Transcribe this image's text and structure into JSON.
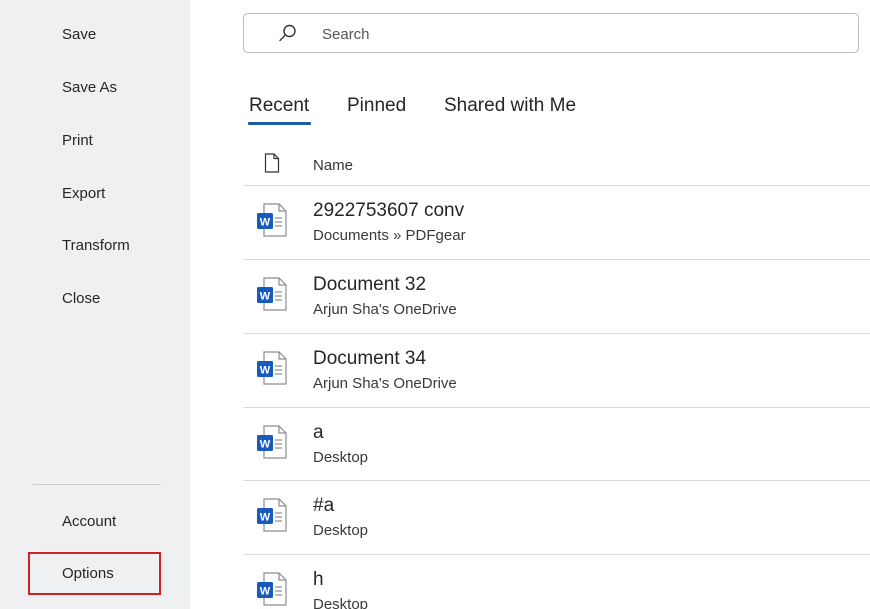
{
  "sidebar": {
    "items": [
      {
        "label": "Save"
      },
      {
        "label": "Save As"
      },
      {
        "label": "Print"
      },
      {
        "label": "Export"
      },
      {
        "label": "Transform"
      },
      {
        "label": "Close"
      }
    ],
    "account_label": "Account",
    "options_label": "Options",
    "highlight_color": "#d0212b"
  },
  "search": {
    "placeholder": "Search",
    "icon": "search-icon"
  },
  "tabs": [
    {
      "label": "Recent",
      "active": true
    },
    {
      "label": "Pinned",
      "active": false
    },
    {
      "label": "Shared with Me",
      "active": false
    }
  ],
  "list": {
    "header_name": "Name",
    "files": [
      {
        "name": "2922753607 conv",
        "location": "Documents » PDFgear",
        "icon": "word-document-icon"
      },
      {
        "name": "Document 32",
        "location": "Arjun Sha's OneDrive",
        "icon": "word-document-icon"
      },
      {
        "name": "Document 34",
        "location": "Arjun Sha's OneDrive",
        "icon": "word-document-icon"
      },
      {
        "name": "a",
        "location": "Desktop",
        "icon": "word-document-icon"
      },
      {
        "name": "#a",
        "location": "Desktop",
        "icon": "word-document-icon"
      },
      {
        "name": "h",
        "location": "Desktop",
        "icon": "word-document-icon"
      }
    ]
  },
  "colors": {
    "accent": "#1f5aa6",
    "word_blue": "#185abd",
    "sidebar_bg": "#eef0f2"
  }
}
